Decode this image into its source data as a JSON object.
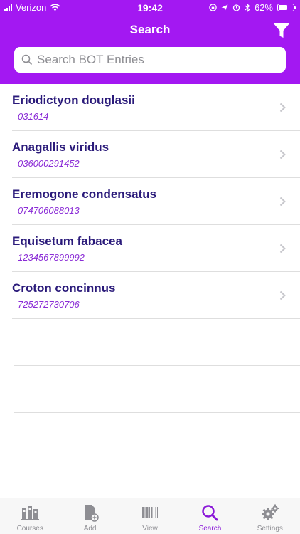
{
  "status_bar": {
    "carrier": "Verizon",
    "time": "19:42",
    "battery_percent": "62%"
  },
  "nav": {
    "title": "Search"
  },
  "search": {
    "placeholder": "Search BOT Entries",
    "value": ""
  },
  "entries": [
    {
      "name": "Eriodictyon douglasii",
      "code": "031614"
    },
    {
      "name": "Anagallis viridus",
      "code": "036000291452"
    },
    {
      "name": "Eremogone condensatus",
      "code": "074706088013"
    },
    {
      "name": "Equisetum fabacea",
      "code": "1234567899992"
    },
    {
      "name": "Croton concinnus",
      "code": "725272730706"
    }
  ],
  "tabs": [
    {
      "label": "Courses",
      "icon": "courses-icon",
      "active": false
    },
    {
      "label": "Add",
      "icon": "add-icon",
      "active": false
    },
    {
      "label": "View",
      "icon": "barcode-icon",
      "active": false
    },
    {
      "label": "Search",
      "icon": "search-icon",
      "active": true
    },
    {
      "label": "Settings",
      "icon": "gear-icon",
      "active": false
    }
  ],
  "colors": {
    "accent": "#a318f2",
    "entry_name": "#2a1a7a",
    "entry_code": "#8a2bd6",
    "tab_active": "#8a18d8",
    "tab_inactive": "#8e8e93"
  }
}
